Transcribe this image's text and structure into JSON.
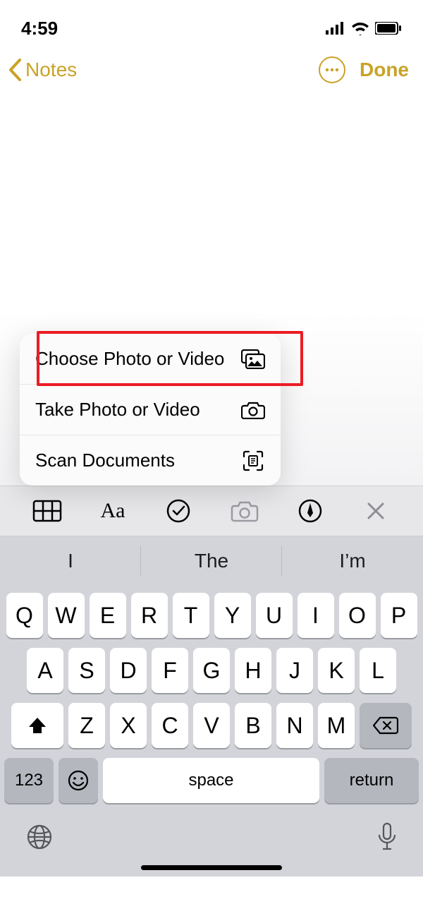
{
  "status": {
    "time": "4:59"
  },
  "nav": {
    "back_label": "Notes",
    "done_label": "Done"
  },
  "popover": {
    "items": [
      {
        "label": "Choose Photo or Video",
        "icon": "photo-library-icon",
        "highlighted": true
      },
      {
        "label": "Take Photo or Video",
        "icon": "camera-icon",
        "highlighted": false
      },
      {
        "label": "Scan Documents",
        "icon": "scan-document-icon",
        "highlighted": false
      }
    ]
  },
  "notes_toolbar": {
    "items": [
      "table",
      "text-format",
      "checklist",
      "camera",
      "markup",
      "close"
    ]
  },
  "predictive": {
    "suggestions": [
      "I",
      "The",
      "I’m"
    ]
  },
  "keyboard": {
    "row1": [
      "Q",
      "W",
      "E",
      "R",
      "T",
      "Y",
      "U",
      "I",
      "O",
      "P"
    ],
    "row2": [
      "A",
      "S",
      "D",
      "F",
      "G",
      "H",
      "J",
      "K",
      "L"
    ],
    "row3": [
      "Z",
      "X",
      "C",
      "V",
      "B",
      "N",
      "M"
    ],
    "numeric_label": "123",
    "space_label": "space",
    "return_label": "return"
  }
}
